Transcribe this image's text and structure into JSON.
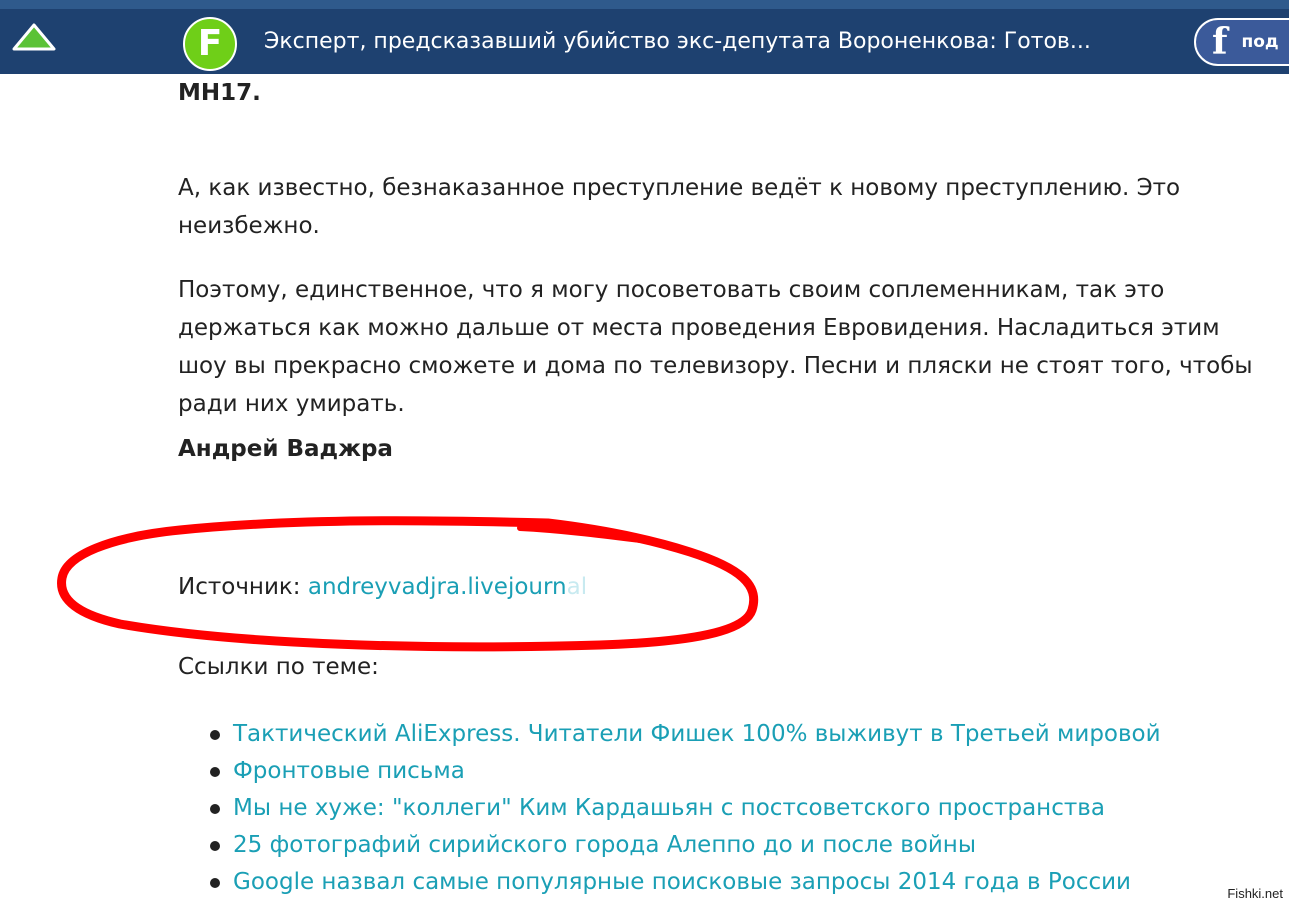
{
  "header": {
    "title": "Эксперт, предсказавший убийство экс-депутата Вороненкова: Готов...",
    "logo_letter": "F",
    "facebook_icon": "f",
    "facebook_label": "под",
    "bg_color": "#1e4170",
    "logo_color": "#6fcf18"
  },
  "article": {
    "mh17": "MH17.",
    "paragraphs": [
      "А, как известно, безнаказанное преступление ведёт к новому преступлению. Это неизбежно.",
      "Поэтому, единственное, что я могу посоветовать своим соплеменникам, так это держаться как можно дальше от места проведения Евровидения. Насладиться этим шоу вы прекрасно сможете и дома по телевизору. Песни и пляски не стоят того, чтобы ради них умирать."
    ],
    "author": "Андрей Ваджра",
    "source_label": "Источник: ",
    "source_link": "andreyvadjra.livejourn",
    "source_link_fade": "al",
    "related_label": "Ссылки по теме:",
    "related_links": [
      "Тактический AliExpress. Читатели Фишек 100% выживут в Третьей мировой",
      "Фронтовые письма",
      "Мы не хуже: \"коллеги\" Ким Кардашьян с постсоветского пространства",
      "25 фотографий сирийского города Алеппо до и после войны",
      "Google назвал самые популярные поисковые запросы 2014 года в России"
    ],
    "link_color": "#1a9fb5"
  },
  "overlay": {
    "annotation_color": "#ff0000"
  },
  "watermark": "Fishki.net"
}
